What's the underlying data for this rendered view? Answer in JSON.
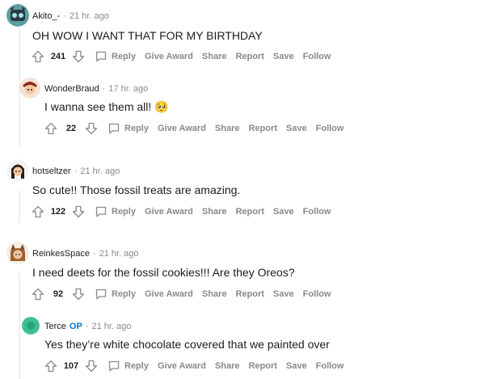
{
  "colors": {
    "accent": "#0079d3",
    "muted": "#878a8c",
    "line": "#edeff1"
  },
  "action_labels": {
    "reply": "Reply",
    "give_award": "Give Award",
    "share": "Share",
    "report": "Report",
    "save": "Save",
    "follow": "Follow"
  },
  "comments": [
    {
      "author": "Akito_-",
      "time": "21 hr. ago",
      "text": "OH WOW I WANT THAT FOR MY BIRTHDAY",
      "votes": "241",
      "op_badge": ""
    },
    {
      "author": "WonderBraud",
      "time": "17 hr. ago",
      "text": "I wanna see them all! 🥺",
      "votes": "22",
      "op_badge": ""
    },
    {
      "author": "hotseltzer",
      "time": "21 hr. ago",
      "text": "So cute!! Those fossil treats are amazing.",
      "votes": "122",
      "op_badge": ""
    },
    {
      "author": "ReinkesSpace",
      "time": "21 hr. ago",
      "text": "I need deets for the fossil cookies!!! Are they Oreos?",
      "votes": "92",
      "op_badge": ""
    },
    {
      "author": "Terce",
      "time": "21 hr. ago",
      "text": "Yes they’re white chocolate covered that we painted over",
      "votes": "107",
      "op_badge": "OP"
    }
  ]
}
